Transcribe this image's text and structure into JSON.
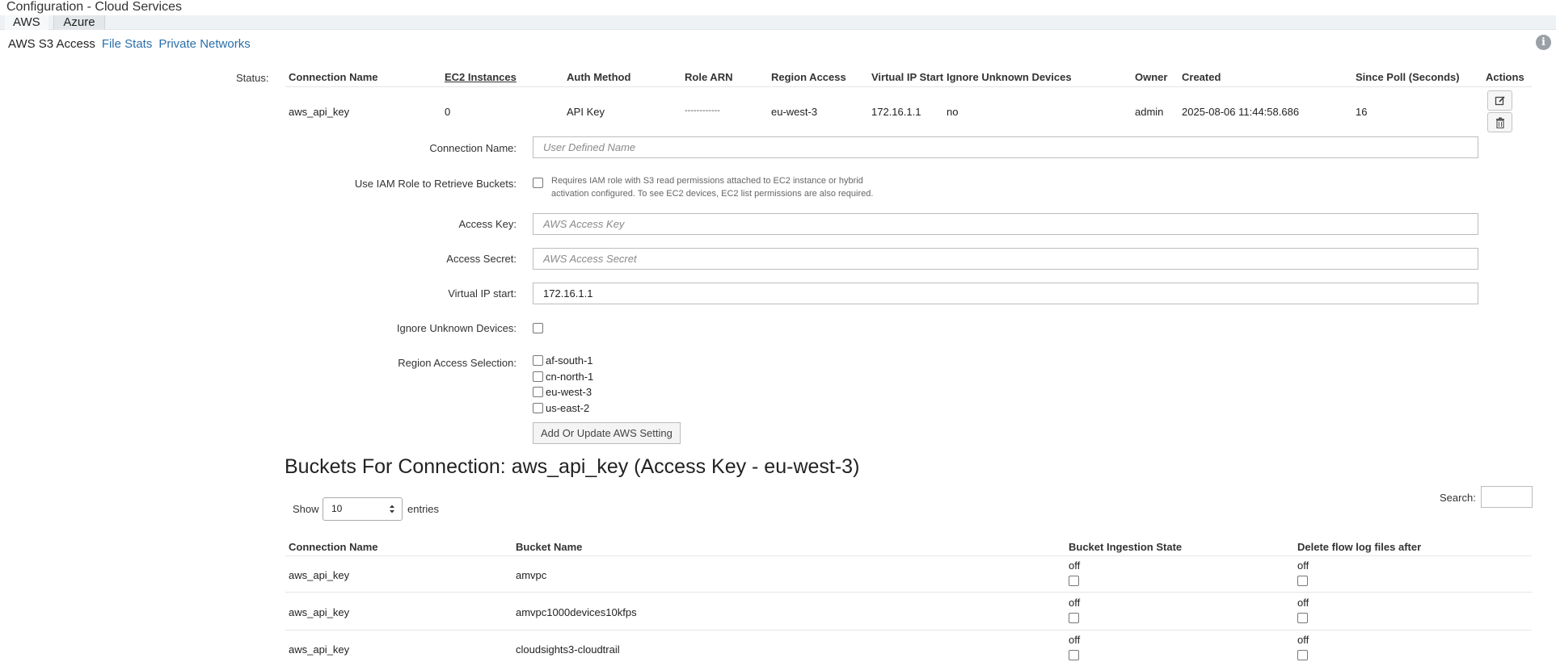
{
  "page_title": "Configuration - Cloud Services",
  "tabs": [
    {
      "label": "AWS"
    },
    {
      "label": "Azure"
    }
  ],
  "subnav": {
    "current": "AWS S3 Access",
    "links": [
      "File Stats",
      "Private Networks"
    ]
  },
  "connections_table": {
    "status_label": "Status:",
    "headers": {
      "connection_name": "Connection Name",
      "ec2_instances": "EC2 Instances",
      "auth_method": "Auth Method",
      "role_arn": "Role ARN",
      "region_access": "Region Access",
      "virtual_ip_start": "Virtual IP Start",
      "ignore_unknown_devices": "Ignore Unknown Devices",
      "owner": "Owner",
      "created": "Created",
      "since_poll": "Since Poll (Seconds)",
      "actions": "Actions"
    },
    "row": {
      "connection_name": "aws_api_key",
      "ec2_instances": "0",
      "auth_method": "API Key",
      "role_arn": "------------",
      "region_access": "eu-west-3",
      "virtual_ip_start": "172.16.1.1",
      "ignore_unknown_devices": "no",
      "owner": "admin",
      "created": "2025-08-06 11:44:58.686",
      "since_poll": "16"
    }
  },
  "form": {
    "connection_name": {
      "label": "Connection Name:",
      "placeholder": "User Defined Name",
      "value": ""
    },
    "use_iam_role": {
      "label": "Use IAM Role to Retrieve Buckets:",
      "help_line1": "Requires IAM role with S3 read permissions attached to EC2 instance or hybrid",
      "help_line2": "activation configured. To see EC2 devices, EC2 list permissions are also required."
    },
    "access_key": {
      "label": "Access Key:",
      "placeholder": "AWS Access Key"
    },
    "access_secret": {
      "label": "Access Secret:",
      "placeholder": "AWS Access Secret"
    },
    "virtual_ip_start": {
      "label": "Virtual IP start:",
      "value": "172.16.1.1"
    },
    "ignore_unknown_devices": {
      "label": "Ignore Unknown Devices:"
    },
    "region_access": {
      "label": "Region Access Selection:",
      "options": [
        "af-south-1",
        "cn-north-1",
        "eu-west-3",
        "us-east-2"
      ]
    },
    "submit_label": "Add Or Update AWS Setting"
  },
  "buckets": {
    "title": "Buckets For Connection: aws_api_key (Access Key - eu-west-3)",
    "show_label": "Show",
    "entries_label": "entries",
    "page_size": "10",
    "search_label": "Search:",
    "headers": {
      "connection_name": "Connection Name",
      "bucket_name": "Bucket Name",
      "ingestion_state": "Bucket Ingestion State",
      "delete_after": "Delete flow log files after"
    },
    "rows": [
      {
        "connection_name": "aws_api_key",
        "bucket_name": "amvpc",
        "ingestion_state": "off",
        "delete_after": "off"
      },
      {
        "connection_name": "aws_api_key",
        "bucket_name": "amvpc1000devices10kfps",
        "ingestion_state": "off",
        "delete_after": "off"
      },
      {
        "connection_name": "aws_api_key",
        "bucket_name": "cloudsights3-cloudtrail",
        "ingestion_state": "off",
        "delete_after": "off"
      }
    ]
  }
}
